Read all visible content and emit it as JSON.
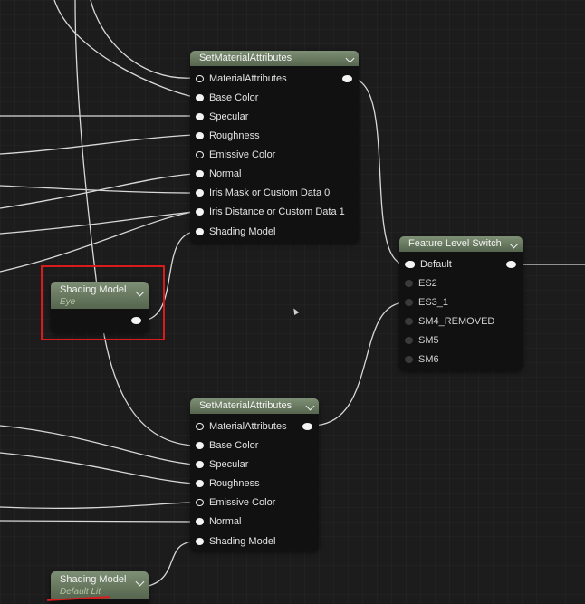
{
  "set_material_attributes_1": {
    "title": "SetMaterialAttributes",
    "pins": [
      "MaterialAttributes",
      "Base Color",
      "Specular",
      "Roughness",
      "Emissive Color",
      "Normal",
      "Iris Mask or Custom Data 0",
      "Iris Distance or Custom Data 1",
      "Shading Model"
    ]
  },
  "set_material_attributes_2": {
    "title": "SetMaterialAttributes",
    "pins": [
      "MaterialAttributes",
      "Base Color",
      "Specular",
      "Roughness",
      "Emissive Color",
      "Normal",
      "Shading Model"
    ]
  },
  "feature_level_switch": {
    "title": "Feature Level Switch",
    "pins": [
      "Default",
      "ES2",
      "ES3_1",
      "SM4_REMOVED",
      "SM5",
      "SM6"
    ]
  },
  "shading_model_eye": {
    "title": "Shading Model",
    "subtitle": "Eye"
  },
  "shading_model_default": {
    "title": "Shading Model",
    "subtitle": "Default Lit"
  },
  "colors": {
    "node_header": "#6b7d62",
    "node_body": "#111111",
    "wire": "#d8d8d8",
    "highlight": "#d81b1b",
    "background": "#1c1c1c"
  }
}
